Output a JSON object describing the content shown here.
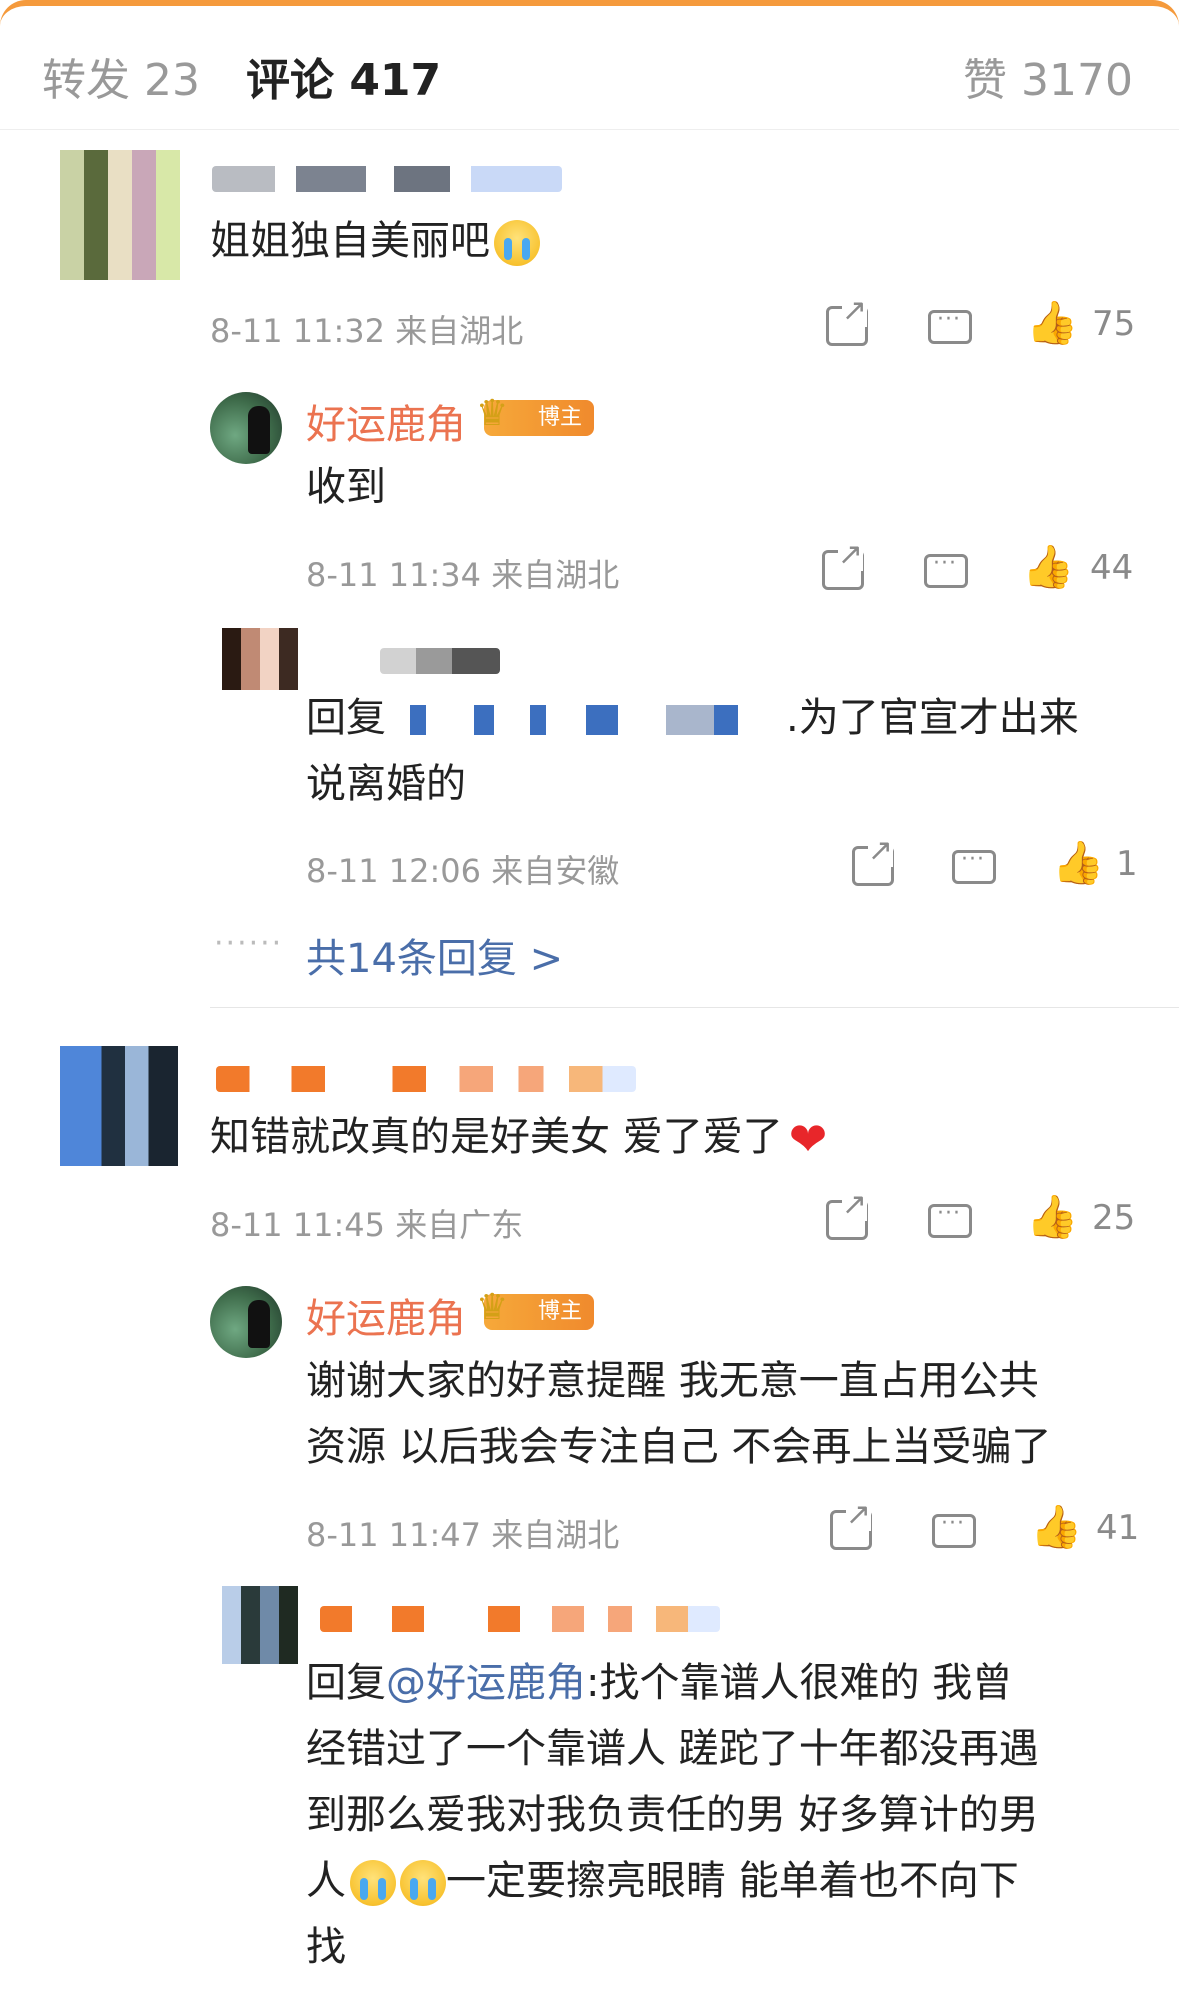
{
  "tabs": {
    "repost": "转发 23",
    "comment": "评论 417",
    "like": "赞 3170"
  },
  "badge": "博主",
  "comments": [
    {
      "text": "姐姐独自美丽吧",
      "meta": "8-11 11:32  来自湖北",
      "likes": "75",
      "reply": {
        "author": "好运鹿角",
        "text": "收到",
        "meta": "8-11 11:34  来自湖北",
        "likes": "44"
      },
      "sub_reply": {
        "text_prefix": "回复",
        "text_suffix": ".为了官宣才出来",
        "text_line2": "说离婚的",
        "meta": "8-11 12:06  来自安徽",
        "likes": "1"
      },
      "more_dots": "······",
      "more": "共14条回复 >"
    },
    {
      "text": "知错就改真的是好美女 爱了爱了",
      "meta": "8-11 11:45  来自广东",
      "likes": "25",
      "reply": {
        "author": "好运鹿角",
        "text_line1": "谢谢大家的好意提醒 我无意一直占用公共",
        "text_line2": "资源 以后我会专注自己 不会再上当受骗了",
        "meta": "8-11 11:47  来自湖北",
        "likes": "41"
      },
      "sub_reply": {
        "prefix": "回复",
        "mention": "@好运鹿角",
        "line1_rest": ":找个靠谱人很难的 我曾",
        "line2": "经错过了一个靠谱人 蹉跎了十年都没再遇",
        "line3": "到那么爱我对我负责任的男 好多算计的男",
        "line4_a": "人",
        "line4_b": "一定要擦亮眼睛 能单着也不向下",
        "line5": "找"
      }
    }
  ]
}
